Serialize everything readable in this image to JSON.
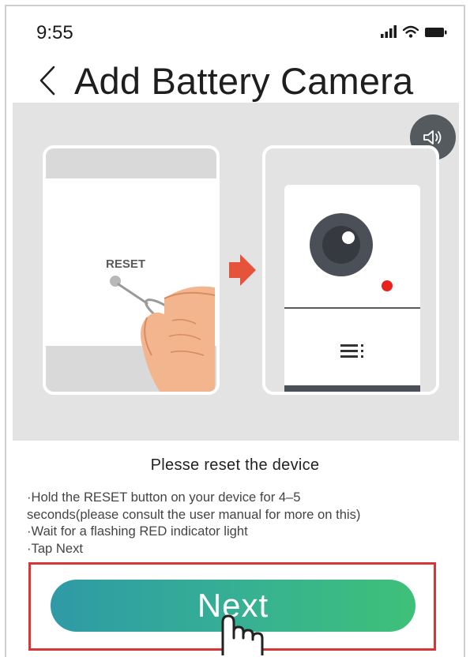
{
  "status_bar": {
    "time": "9:55",
    "icons": [
      "signal-icon",
      "wifi-icon",
      "battery-icon"
    ]
  },
  "header": {
    "back_icon": "chevron-left-icon",
    "title": "Add Battery Camera"
  },
  "illustration": {
    "speaker_icon": "speaker-icon",
    "reset_label": "RESET",
    "arrow_color": "#e5533a",
    "indicator_color": "#e8231f"
  },
  "instructions": {
    "title": "Plesse reset the device",
    "lines": [
      "·Hold the RESET button on your device for 4–5",
      "seconds(please consult the user manual for more on this)",
      "·Wait for a flashing RED indicator light",
      "·Tap Next"
    ]
  },
  "next_button": {
    "label": "Next",
    "gradient_start": "#2e9aa6",
    "gradient_end": "#3fc078"
  },
  "highlight_color": "#d9363a"
}
